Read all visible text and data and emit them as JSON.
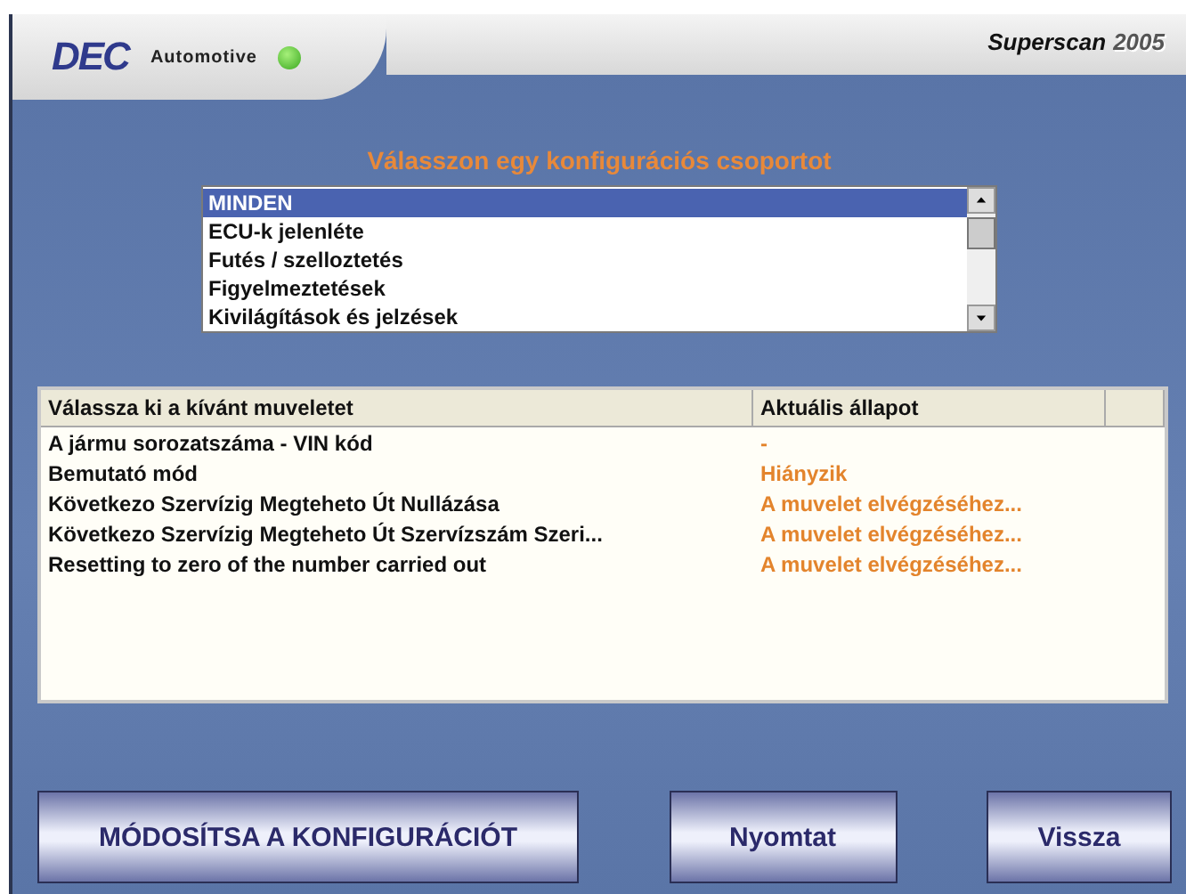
{
  "header": {
    "logo": "DEC",
    "brand": "Automotive",
    "product": "Superscan",
    "year": "2005"
  },
  "prompt": "Válasszon egy konfigurációs csoportot",
  "groups": [
    {
      "label": "MINDEN",
      "selected": true
    },
    {
      "label": "ECU-k jelenléte",
      "selected": false
    },
    {
      "label": "Futés / szelloztetés",
      "selected": false
    },
    {
      "label": "Figyelmeztetések",
      "selected": false
    },
    {
      "label": "Kivilágítások és jelzések",
      "selected": false
    }
  ],
  "table": {
    "columns": [
      "Válassza ki a kívánt muveletet",
      "Aktuális állapot"
    ],
    "rows": [
      {
        "operation": "A jármu sorozatszáma - VIN kód",
        "status": "-"
      },
      {
        "operation": "Bemutató mód",
        "status": "Hiányzik"
      },
      {
        "operation": "Következo Szervízig Megteheto Út Nullázása",
        "status": "A muvelet elvégzéséhez..."
      },
      {
        "operation": "Következo Szervízig Megteheto Út Szervízszám Szeri...",
        "status": "A muvelet elvégzéséhez..."
      },
      {
        "operation": "Resetting to zero of the number carried out",
        "status": "A muvelet elvégzéséhez..."
      }
    ]
  },
  "buttons": [
    "MÓDOSÍTSA A KONFIGURÁCIÓT",
    "Nyomtat",
    "Vissza"
  ]
}
